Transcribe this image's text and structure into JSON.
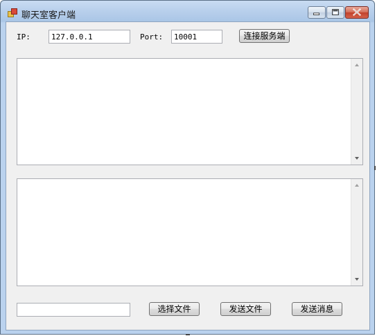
{
  "window": {
    "title": "聊天室客户端"
  },
  "connection": {
    "ip_label": "IP:",
    "ip_value": "127.0.0.1",
    "port_label": "Port:",
    "port_value": "10001",
    "connect_button": "连接服务端"
  },
  "message_log": {
    "content": ""
  },
  "message_input": {
    "content": ""
  },
  "file_bar": {
    "file_path": "",
    "select_file_button": "选择文件",
    "send_file_button": "发送文件",
    "send_message_button": "发送消息"
  },
  "icons": [
    "app-icon",
    "minimize-icon",
    "maximize-icon",
    "close-icon",
    "scroll-up-icon",
    "scroll-down-icon"
  ]
}
